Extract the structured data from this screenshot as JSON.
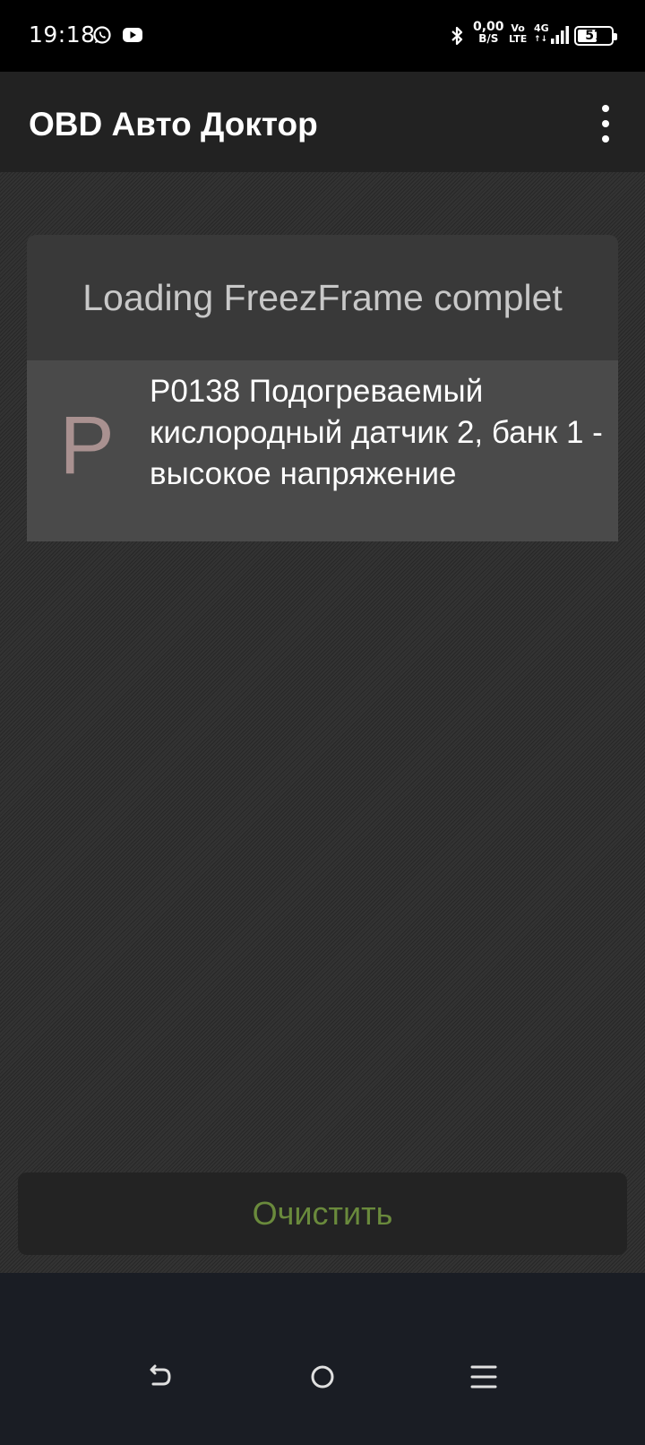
{
  "status_bar": {
    "time": "19:18",
    "notification_icons": [
      "whatsapp-icon",
      "youtube-icon"
    ],
    "net_speed_value": "0,00",
    "net_speed_unit": "B/S",
    "volte_top": "Vo",
    "volte_bottom": "LTE",
    "network_type": "4G",
    "network_arrows": "↑↓",
    "battery_level": "57",
    "battery_fraction": 0.57
  },
  "app_bar": {
    "title": "OBD Авто Доктор",
    "overflow_icon": "more-vert-icon"
  },
  "card": {
    "header": "Loading FreezFrame complet",
    "items": [
      {
        "letter": "P",
        "text": "P0138 Подогреваемый кислородный датчик 2, банк 1 - высокое напряжение"
      }
    ]
  },
  "actions": {
    "clear_label": "Очистить"
  },
  "nav_bar": {
    "icons": [
      "back-icon",
      "home-icon",
      "recents-icon"
    ]
  },
  "colors": {
    "status_bar_bg": "#000000",
    "app_bar_bg": "#222222",
    "card_header_bg": "#393939",
    "dtc_row_bg": "#4a4a4a",
    "dtc_letter": "#a99190",
    "clear_label": "#6a8a3c",
    "nav_bar_bg": "#1a1d24"
  }
}
